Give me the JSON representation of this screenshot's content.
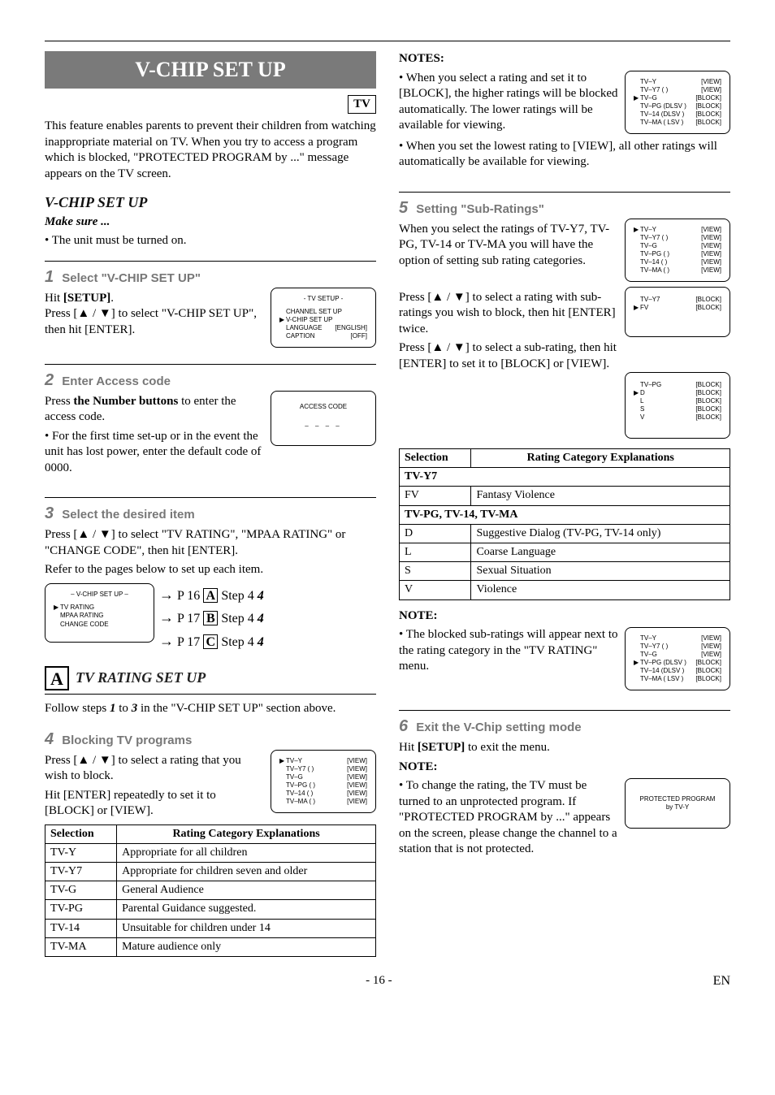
{
  "domain": "Paper",
  "title": "V-CHIP SET UP",
  "tv_badge": "TV",
  "intro": "This feature enables parents to prevent their children from watching inappropriate material on TV. When you try to access a program which is blocked, \"PROTECTED PROGRAM by ...\" message appears on the TV screen.",
  "sectionA": {
    "heading": "V-CHIP SET UP",
    "makesure": "Make sure ...",
    "bullets": [
      "The unit must be turned on."
    ],
    "step1": {
      "num": "1",
      "title": "Select \"V-CHIP SET UP\"",
      "body": "Hit [SETUP].",
      "body2": "Press [▲ / ▼] to select \"V-CHIP SET UP\", then hit [ENTER].",
      "osd_title": "- TV SETUP -",
      "osd_rows": [
        {
          "ptr": "",
          "l": "CHANNEL SET UP",
          "r": ""
        },
        {
          "ptr": "▶",
          "l": "V-CHIP SET UP",
          "r": ""
        },
        {
          "ptr": "",
          "l": "LANGUAGE",
          "r": "[ENGLISH]"
        },
        {
          "ptr": "",
          "l": "CAPTION",
          "r": "[OFF]"
        }
      ]
    },
    "step2": {
      "num": "2",
      "title": "Enter Access code",
      "body1_a": "Press ",
      "body1_b": "the Number buttons",
      "body1_c": " to enter the access code.",
      "bullet": "For the first time set-up or in the event the unit has lost power, enter the default code of 0000.",
      "osd_title": "ACCESS CODE",
      "osd_code": "– – – –"
    },
    "step3": {
      "num": "3",
      "title": "Select the desired item",
      "body": "Press [▲ / ▼] to select \"TV RATING\", \"MPAA RATING\" or \"CHANGE CODE\", then hit [ENTER].",
      "body2": "Refer to the pages below to set up each item.",
      "osd_title": "– V-CHIP SET UP –",
      "osd_rows": [
        {
          "ptr": "▶",
          "l": "TV RATING"
        },
        {
          "ptr": "",
          "l": "MPAA RATING"
        },
        {
          "ptr": "",
          "l": "CHANGE CODE"
        }
      ],
      "links": [
        {
          "arrow": "→",
          "page": "P 16",
          "letter": "A",
          "step": "Step 4"
        },
        {
          "arrow": "→",
          "page": "P 17",
          "letter": "B",
          "step": "Step 4"
        },
        {
          "arrow": "→",
          "page": "P 17",
          "letter": "C",
          "step": "Step 4"
        }
      ]
    }
  },
  "sectionTV": {
    "letter": "A",
    "heading": "TV RATING SET UP",
    "intro_a": "Follow steps ",
    "intro_b": " to ",
    "intro_c": " in the \"V-CHIP SET UP\" section above.",
    "s1": "1",
    "s3": "3",
    "step4": {
      "num": "4",
      "title": "Blocking TV programs",
      "body": "Press [▲ / ▼] to select a rating that you wish to block.",
      "body2": "Hit [ENTER] repeatedly to set it to [BLOCK] or [VIEW].",
      "osd_rows": [
        {
          "ptr": "▶",
          "l": "TV–Y",
          "r": "[VIEW]"
        },
        {
          "ptr": "",
          "l": "TV–Y7 (        )",
          "r": "[VIEW]"
        },
        {
          "ptr": "",
          "l": "TV–G",
          "r": "[VIEW]"
        },
        {
          "ptr": "",
          "l": "TV–PG (        )",
          "r": "[VIEW]"
        },
        {
          "ptr": "",
          "l": "TV–14 (        )",
          "r": "[VIEW]"
        },
        {
          "ptr": "",
          "l": "TV–MA (        )",
          "r": "[VIEW]"
        }
      ]
    },
    "table1_h1": "Selection",
    "table1_h2": "Rating Category Explanations",
    "table1": [
      {
        "s": "TV-Y",
        "e": "Appropriate for all children"
      },
      {
        "s": "TV-Y7",
        "e": "Appropriate for children seven and older"
      },
      {
        "s": "TV-G",
        "e": "General Audience"
      },
      {
        "s": "TV-PG",
        "e": "Parental Guidance suggested."
      },
      {
        "s": "TV-14",
        "e": "Unsuitable for children under 14"
      },
      {
        "s": "TV-MA",
        "e": "Mature audience only"
      }
    ]
  },
  "right": {
    "notes_h": "NOTES:",
    "notes": [
      "When you select a rating and set it to [BLOCK], the higher ratings will be blocked automatically. The lower ratings will be available for viewing.",
      "When you set the lowest rating to [VIEW], all other ratings will automatically be available for viewing."
    ],
    "osd_notes_rows": [
      {
        "ptr": "",
        "l": "TV–Y",
        "r": "[VIEW]"
      },
      {
        "ptr": "",
        "l": "TV–Y7 (        )",
        "r": "[VIEW]"
      },
      {
        "ptr": "▶",
        "l": "TV–G",
        "r": "[BLOCK]"
      },
      {
        "ptr": "",
        "l": "TV–PG (DLSV )",
        "r": "[BLOCK]"
      },
      {
        "ptr": "",
        "l": "TV–14  (DLSV )",
        "r": "[BLOCK]"
      },
      {
        "ptr": "",
        "l": "TV–MA (  LSV )",
        "r": "[BLOCK]"
      }
    ],
    "step5": {
      "num": "5",
      "title": "Setting \"Sub-Ratings\"",
      "p1": "When you select the ratings of TV-Y7, TV-PG, TV-14 or TV-MA you will have the option of setting sub rating categories.",
      "p2": "Press [▲ / ▼] to select a rating with sub-ratings you wish to block, then hit [ENTER] twice.",
      "p3": "Press [▲ / ▼] to select a sub-rating, then hit [ENTER] to set it to [BLOCK] or [VIEW].",
      "osd1": [
        {
          "ptr": "▶",
          "l": "TV–Y",
          "r": "[VIEW]"
        },
        {
          "ptr": "",
          "l": "TV–Y7 (        )",
          "r": "[VIEW]"
        },
        {
          "ptr": "",
          "l": "TV–G",
          "r": "[VIEW]"
        },
        {
          "ptr": "",
          "l": "TV–PG (        )",
          "r": "[VIEW]"
        },
        {
          "ptr": "",
          "l": "TV–14 (        )",
          "r": "[VIEW]"
        },
        {
          "ptr": "",
          "l": "TV–MA (        )",
          "r": "[VIEW]"
        }
      ],
      "osd2": [
        {
          "ptr": "",
          "l": "TV–Y7",
          "r": "[BLOCK]"
        },
        {
          "ptr": "▶",
          "l": "FV",
          "r": "[BLOCK]"
        }
      ],
      "osd3": [
        {
          "ptr": "",
          "l": "TV–PG",
          "r": "[BLOCK]"
        },
        {
          "ptr": "▶",
          "l": "D",
          "r": "[BLOCK]"
        },
        {
          "ptr": "",
          "l": "L",
          "r": "[BLOCK]"
        },
        {
          "ptr": "",
          "l": "S",
          "r": "[BLOCK]"
        },
        {
          "ptr": "",
          "l": "V",
          "r": "[BLOCK]"
        }
      ]
    },
    "table2_h1": "Selection",
    "table2_h2": "Rating Category Explanations",
    "table2_group1": "TV-Y7",
    "table2_row1": {
      "s": "FV",
      "e": "Fantasy Violence"
    },
    "table2_group2": "TV-PG, TV-14, TV-MA",
    "table2_rows": [
      {
        "s": "D",
        "e": "Suggestive Dialog   (TV-PG, TV-14 only)"
      },
      {
        "s": "L",
        "e": "Coarse Language"
      },
      {
        "s": "S",
        "e": "Sexual Situation"
      },
      {
        "s": "V",
        "e": "Violence"
      }
    ],
    "note_h": "NOTE:",
    "note1": "The blocked sub-ratings will appear next to the rating category in the \"TV RATING\" menu.",
    "osd_note_rows": [
      {
        "ptr": "",
        "l": "TV–Y",
        "r": "[VIEW]"
      },
      {
        "ptr": "",
        "l": "TV–Y7 (        )",
        "r": "[VIEW]"
      },
      {
        "ptr": "",
        "l": "TV–G",
        "r": "[VIEW]"
      },
      {
        "ptr": "▶",
        "l": "TV–PG (DLSV )",
        "r": "[BLOCK]"
      },
      {
        "ptr": "",
        "l": "TV–14  (DLSV )",
        "r": "[BLOCK]"
      },
      {
        "ptr": "",
        "l": "TV–MA (  LSV )",
        "r": "[BLOCK]"
      }
    ],
    "step6": {
      "num": "6",
      "title": "Exit the V-Chip setting mode",
      "body": "Hit [SETUP] to exit the menu.",
      "note_h": "NOTE:",
      "note": "To change the rating, the TV must be turned to an unprotected program. If \"PROTECTED PROGRAM by ...\" appears on the screen, please change the channel to a station that is not protected.",
      "osd_text1": "PROTECTED PROGRAM",
      "osd_text2": "by TV-Y"
    }
  },
  "footer": {
    "page": "- 16 -",
    "en": "EN"
  }
}
